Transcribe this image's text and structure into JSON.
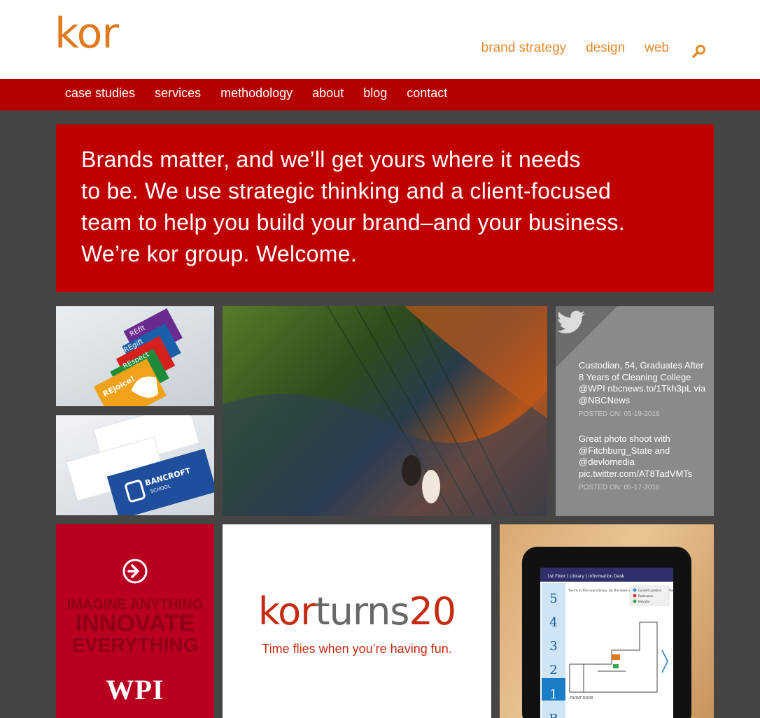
{
  "logo": {
    "text": "kor"
  },
  "brand_nav": [
    {
      "label": "brand strategy"
    },
    {
      "label": "design"
    },
    {
      "label": "web"
    }
  ],
  "main_nav": [
    {
      "label": "case studies"
    },
    {
      "label": "services"
    },
    {
      "label": "methodology"
    },
    {
      "label": "about"
    },
    {
      "label": "blog"
    },
    {
      "label": "contact"
    }
  ],
  "hero": {
    "line1": "Brands matter, and we’ll get yours where it needs",
    "line2": "to be. We use strategic thinking and a client-focused",
    "line3": "team to help you build your brand–and your business.",
    "line4": "We’re kor group. Welcome."
  },
  "tweets": [
    {
      "text": "Custodian, 54, Graduates After 8 Years of Cleaning College @WPI nbcnews.to/1Tkh3pL via @NBCNews",
      "date": "POSTED ON: 05-19-2016"
    },
    {
      "text": "Great photo shoot with @Fitchburg_State and @devlomedia pic.twitter.com/AT8TadVMTs",
      "date": "POSTED ON: 05-17-2016"
    }
  ],
  "wpi_tile": {
    "line1": "IMAGINE ANYTHING",
    "line2": "INNOVATE",
    "line3": "EVERYTHING",
    "logo": "WPI"
  },
  "cards_tile": {
    "labels": [
      "REspect",
      "REjoice!",
      "REgift",
      "REfit"
    ]
  },
  "bancroft_tile": {
    "label": "BANCROFT",
    "sublabel": "SCHOOL"
  },
  "anniversary": {
    "kor": "kor",
    "turns": "turns",
    "num": "20",
    "tagline": "Time flies when you’re having fun."
  },
  "ipad_tile": {
    "floors": [
      "5",
      "4",
      "3",
      "2",
      "1",
      "B"
    ],
    "bar_label": "1st Floor | Library | Information Desk",
    "legend": [
      "Current Location",
      "Restrooms",
      "Elevator"
    ],
    "bottom_label": "FRONT DOOR",
    "direction_text": "You're in the Law Library, by the desk where you picked up the iPad."
  },
  "colors": {
    "brand_orange": "#e58a2a",
    "nav_red": "#b40000",
    "hero_red": "#bf0000",
    "background": "#474444",
    "twitter_gray": "#8c8a88"
  }
}
